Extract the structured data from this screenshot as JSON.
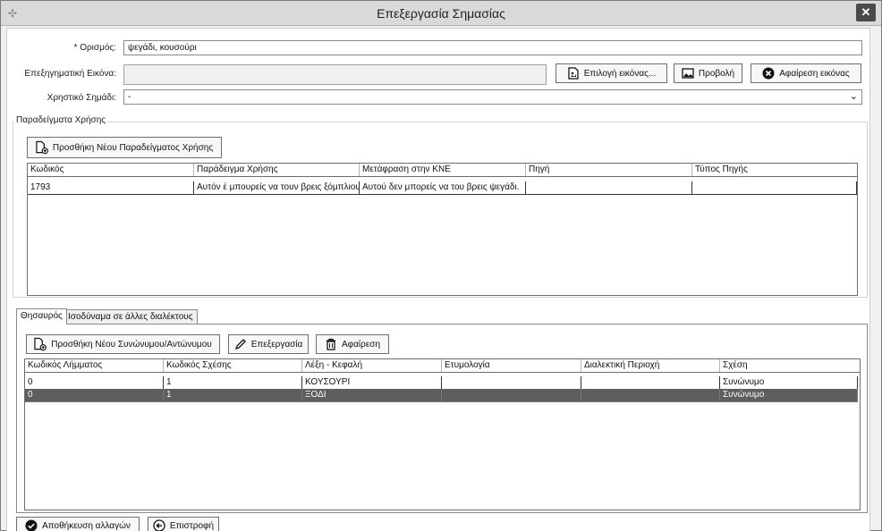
{
  "window": {
    "title": "Επεξεργασία Σημασίας",
    "close_label": "✕"
  },
  "form": {
    "definition_label": "* Ορισμός:",
    "definition_value": "ψεγάδι, κουσούρι",
    "image_label": "Επεξηγηματική Εικόνα:",
    "image_value": "",
    "choose_image_label": "Επιλογή εικόνας...",
    "view_label": "Προβολή",
    "remove_image_label": "Αφαίρεση εικόνας",
    "usage_label": "Χρηστικό Σημάδι:",
    "usage_value": "-"
  },
  "examples": {
    "group_label": "Παραδείγματα Χρήσης",
    "add_label": "Προσθήκη Νέου Παραδείγματος Χρήσης",
    "columns": [
      "Κωδικός",
      "Παράδειγμα Χρήσης",
      "Μετάφραση στην ΚΝΕ",
      "Πηγή",
      "Τύπος Πηγής"
    ],
    "rows": [
      [
        "1793",
        "Αυτόν έ μπουρείς να τουν βρεις ξόμπλιου.",
        "Αυτού δεν μπορείς να του βρεις ψεγάδι.",
        "",
        ""
      ]
    ]
  },
  "tabs": {
    "items": [
      "Θησαυρός",
      "Ισοδύναμα σε άλλες διαλέκτους"
    ],
    "active": 0
  },
  "thesaurus": {
    "add_label": "Προσθήκη Νέου Συνώνυμου/Αντώνυμου",
    "edit_label": "Επεξεργασία",
    "remove_label": "Αφαίρεση",
    "columns": [
      "Κωδικός Λήμματος",
      "Κωδικός Σχέσης",
      "Λέξη - Κεφαλή",
      "Ετυμολογία",
      "Διαλεκτική Περιοχή",
      "Σχέση"
    ],
    "rows": [
      [
        "0",
        "1",
        "ΚΟΥΣΟΥΡΙ",
        "",
        "",
        "Συνώνυμο"
      ],
      [
        "0",
        "1",
        "ΞΟΔΙ",
        "",
        "",
        "Συνώνυμο"
      ]
    ],
    "selected_row": 1
  },
  "footer": {
    "save_label": "Αποθήκευση αλλαγών",
    "back_label": "Επιστροφή"
  }
}
